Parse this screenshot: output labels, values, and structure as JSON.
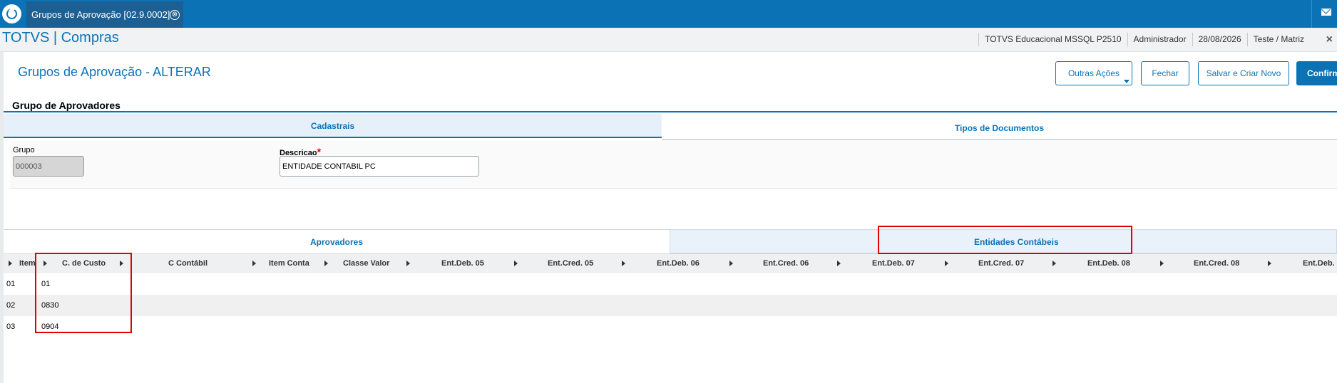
{
  "topbar": {
    "tab_title": "Grupos de Aprovação [02.9.0002]",
    "tab_close": "⊗"
  },
  "titlebar": {
    "app_title": "TOTVS | Compras",
    "environment": "TOTVS Educacional MSSQL P2510",
    "user": "Administrador",
    "date": "28/08/2026",
    "company": "Teste / Matriz",
    "close": "×"
  },
  "form": {
    "title": "Grupos de Aprovação - ALTERAR",
    "actions": {
      "outras_acoes": "Outras Ações",
      "fechar": "Fechar",
      "salvar_criar": "Salvar e Criar Novo",
      "confirmar": "Confirmar"
    },
    "section_title": "Grupo de Aprovadores",
    "tabs": [
      "Cadastrais",
      "Tipos de Documentos"
    ],
    "fields": {
      "grupo_label": "Grupo",
      "grupo_value": "000003",
      "descricao_label": "Descricao",
      "required_mark": "*",
      "descricao_value": "ENTIDADE CONTABIL PC"
    }
  },
  "detail": {
    "tabs": [
      "Aprovadores",
      "Entidades Contábeis"
    ],
    "columns": [
      "Item",
      "C. de Custo",
      "C Contábil",
      "Item Conta",
      "Classe Valor",
      "Ent.Deb. 05",
      "Ent.Cred. 05",
      "Ent.Deb. 06",
      "Ent.Cred. 06",
      "Ent.Deb. 07",
      "Ent.Cred. 07",
      "Ent.Deb. 08",
      "Ent.Cred. 08",
      "Ent.Deb."
    ],
    "rows": [
      {
        "item": "01",
        "c_custo": "01"
      },
      {
        "item": "02",
        "c_custo": "0830"
      },
      {
        "item": "03",
        "c_custo": "0904"
      }
    ]
  },
  "colors": {
    "brand": "#0b73b5",
    "highlight": "#e00000"
  }
}
